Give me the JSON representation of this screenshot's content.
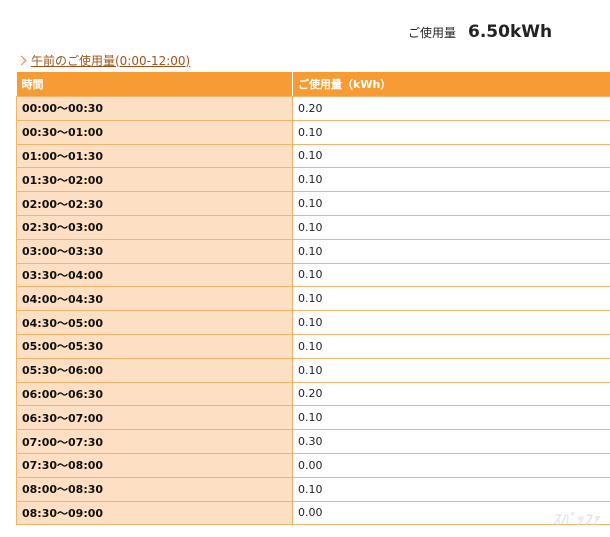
{
  "summary": {
    "label": "ご使用量",
    "value": "6.50kWh"
  },
  "section_link": {
    "label": "午前のご使用量(0:00-12:00)"
  },
  "table": {
    "headers": [
      "時間",
      "ご使用量（kWh）"
    ],
    "rows": [
      {
        "time": "00:00～00:30",
        "value": "0.20"
      },
      {
        "time": "00:30～01:00",
        "value": "0.10"
      },
      {
        "time": "01:00～01:30",
        "value": "0.10"
      },
      {
        "time": "01:30～02:00",
        "value": "0.10"
      },
      {
        "time": "02:00～02:30",
        "value": "0.10"
      },
      {
        "time": "02:30～03:00",
        "value": "0.10"
      },
      {
        "time": "03:00～03:30",
        "value": "0.10"
      },
      {
        "time": "03:30～04:00",
        "value": "0.10"
      },
      {
        "time": "04:00～04:30",
        "value": "0.10"
      },
      {
        "time": "04:30～05:00",
        "value": "0.10"
      },
      {
        "time": "05:00～05:30",
        "value": "0.10"
      },
      {
        "time": "05:30～06:00",
        "value": "0.10"
      },
      {
        "time": "06:00～06:30",
        "value": "0.20"
      },
      {
        "time": "06:30～07:00",
        "value": "0.10"
      },
      {
        "time": "07:00～07:30",
        "value": "0.30"
      },
      {
        "time": "07:30～08:00",
        "value": "0.00"
      },
      {
        "time": "08:00～08:30",
        "value": "0.10"
      },
      {
        "time": "08:30～09:00",
        "value": "0.00"
      }
    ]
  },
  "watermark": "ｽﾊﾞｯﾌｧ",
  "colors": {
    "header_bg": "#f79c33",
    "time_cell_bg": "#fde0c3",
    "border": "#f2b36a",
    "link": "#a0521c"
  }
}
